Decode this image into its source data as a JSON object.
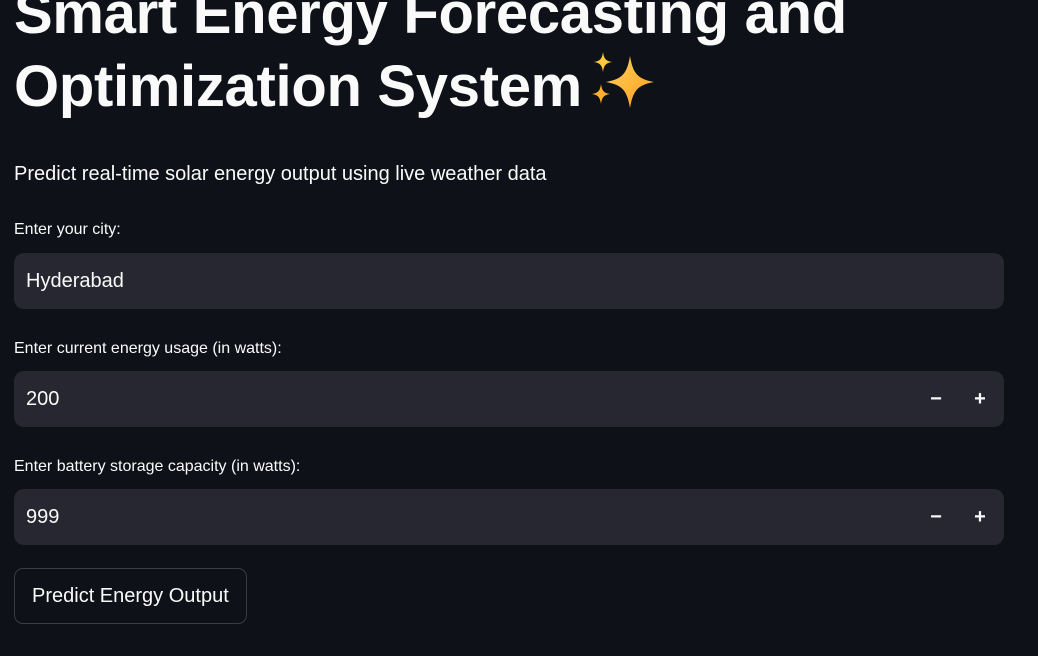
{
  "header": {
    "title_line1": "Smart Energy Forecasting and",
    "title_line2": "Optimization System",
    "title_icon": "sparkles-icon",
    "subtitle": "Predict real-time solar energy output using live weather data"
  },
  "form": {
    "city": {
      "label": "Enter your city:",
      "value": "Hyderabad"
    },
    "energy_usage": {
      "label": "Enter current energy usage (in watts):",
      "value": "200",
      "decrement": "−",
      "increment": "+"
    },
    "battery_capacity": {
      "label": "Enter battery storage capacity (in watts):",
      "value": "999",
      "decrement": "−",
      "increment": "+"
    },
    "submit_label": "Predict Energy Output"
  },
  "colors": {
    "background": "#0e1117",
    "input_background": "#262730",
    "text": "#fafafa",
    "sparkle": "#ffb02e"
  }
}
